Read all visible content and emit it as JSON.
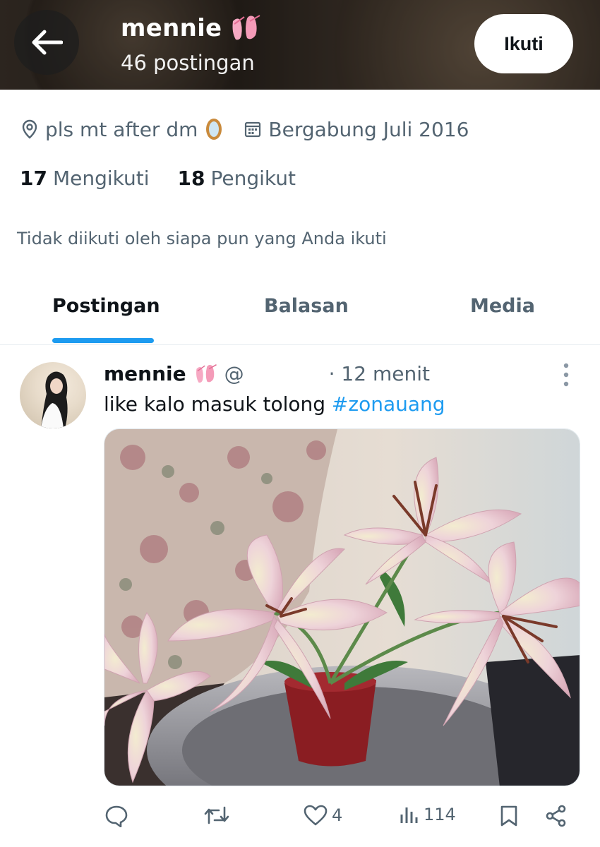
{
  "header": {
    "name": "mennie",
    "post_count": "46 postingan",
    "follow_label": "Ikuti"
  },
  "profile": {
    "location": "pls mt after dm",
    "joined": "Bergabung Juli 2016",
    "following_count": "17",
    "following_label": "Mengikuti",
    "followers_count": "18",
    "followers_label": "Pengikut",
    "mutuals_text": "Tidak diikuti oleh siapa pun yang Anda ikuti"
  },
  "tabs": [
    {
      "label": "Postingan",
      "active": true
    },
    {
      "label": "Balasan",
      "active": false
    },
    {
      "label": "Media",
      "active": false
    }
  ],
  "post": {
    "name": "mennie",
    "handle": "@",
    "time": "· 12 menit",
    "text": "like kalo masuk tolong ",
    "hashtag": "#zonauang",
    "likes": "4",
    "views": "114"
  },
  "colors": {
    "accent": "#1d9bf0",
    "text": "#0f1419",
    "secondary": "#536471"
  },
  "icons": [
    "back-arrow-icon",
    "ballet-shoes-emoji",
    "location-pin-icon",
    "mirror-emoji",
    "calendar-icon",
    "more-vertical-icon",
    "reply-icon",
    "repost-icon",
    "like-icon",
    "views-icon",
    "bookmark-icon",
    "share-icon"
  ]
}
